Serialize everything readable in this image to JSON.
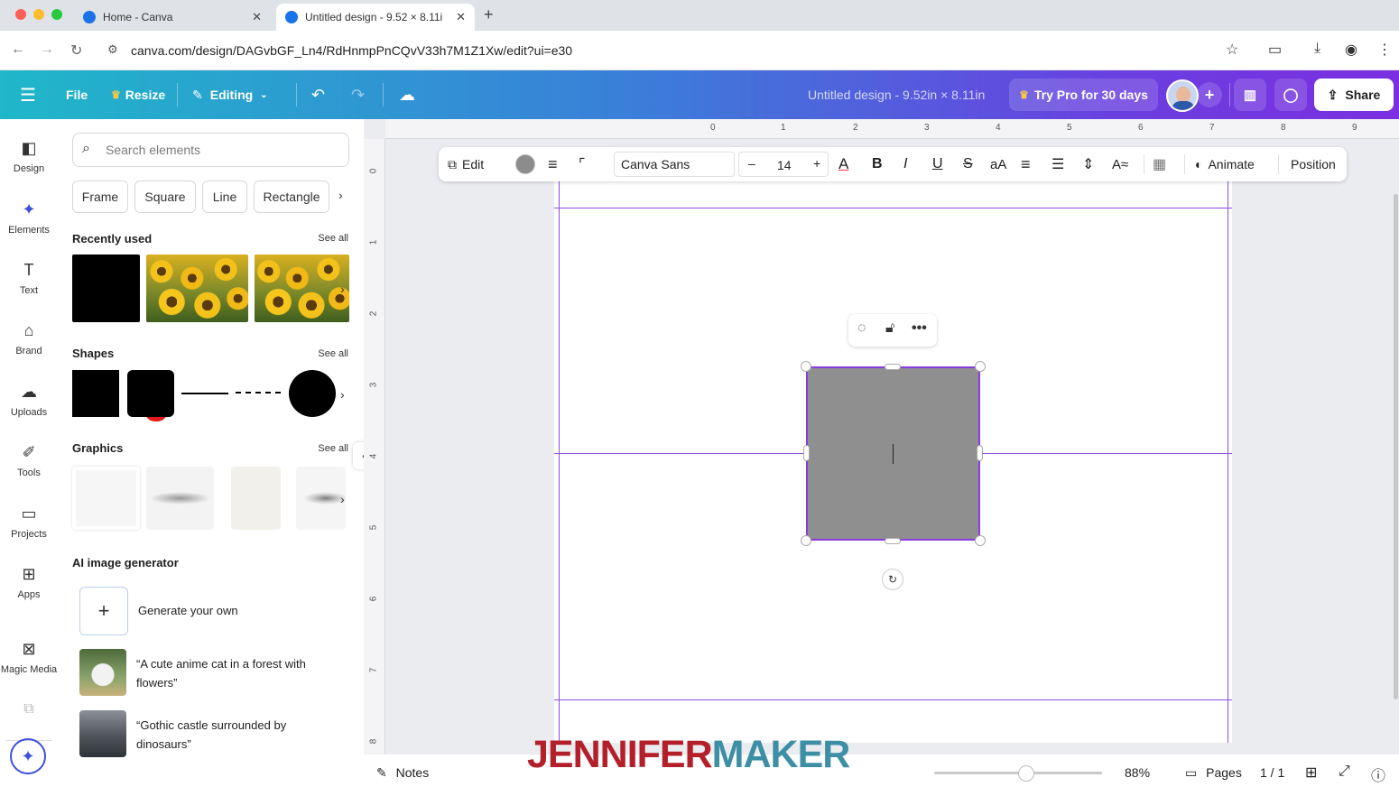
{
  "browser": {
    "tabs": [
      {
        "title": "Home - Canva"
      },
      {
        "title": "Untitled design - 9.52 × 8.11i"
      }
    ],
    "url": "canva.com/design/DAGvbGF_Ln4/RdHnmpPnCQvV33h7M1Z1Xw/edit?ui=e30"
  },
  "header": {
    "file": "File",
    "resize": "Resize",
    "editing": "Editing",
    "title": "Untitled design - 9.52in × 8.11in",
    "try_pro": "Try Pro for 30 days",
    "share": "Share"
  },
  "rail": [
    {
      "label": "Design",
      "icon": "design-icon"
    },
    {
      "label": "Elements",
      "icon": "elements-icon"
    },
    {
      "label": "Text",
      "icon": "text-icon"
    },
    {
      "label": "Brand",
      "icon": "brand-icon"
    },
    {
      "label": "Uploads",
      "icon": "uploads-icon"
    },
    {
      "label": "Tools",
      "icon": "tools-icon"
    },
    {
      "label": "Projects",
      "icon": "projects-icon"
    },
    {
      "label": "Apps",
      "icon": "apps-icon"
    },
    {
      "label": "Magic Media",
      "icon": "magic-media-icon"
    }
  ],
  "panel": {
    "search_placeholder": "Search elements",
    "chips": [
      "Frame",
      "Square",
      "Line",
      "Rectangle"
    ],
    "recently_used": "Recently used",
    "shapes": "Shapes",
    "graphics": "Graphics",
    "see_all": "See all",
    "ai_title": "AI image generator",
    "generate": "Generate your own",
    "prompt1": "“A cute anime cat in a forest with flowers”",
    "prompt2": "“Gothic castle surrounded by dinosaurs”"
  },
  "toolbar": {
    "edit": "Edit",
    "font": "Canva Sans",
    "size": "14",
    "aa": "aA",
    "animate": "Animate",
    "position": "Position"
  },
  "rulers": {
    "top": [
      "0",
      "1",
      "2",
      "3",
      "4",
      "5",
      "6",
      "7",
      "8",
      "9"
    ],
    "left": [
      "0",
      "1",
      "2",
      "3",
      "4",
      "5",
      "6",
      "7",
      "8"
    ]
  },
  "footer": {
    "notes": "Notes",
    "zoom": "88%",
    "pages": "Pages",
    "page_count": "1 / 1"
  },
  "watermark": {
    "part1": "JENNIFER",
    "part2": "MAKER"
  },
  "colors": {
    "accent": "#8b3cdf",
    "shape_fill": "#8f8f8f",
    "rail_active": "#3b4fd8"
  }
}
